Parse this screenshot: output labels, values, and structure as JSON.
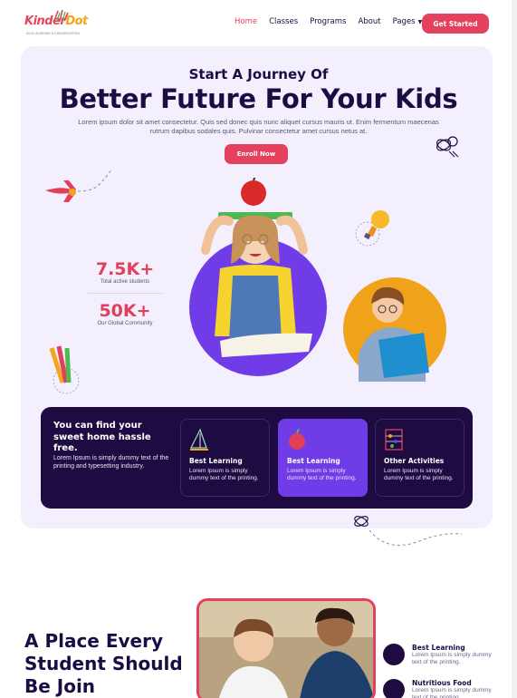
{
  "logo": {
    "kinder": "Kinder",
    "dot": "Dot",
    "tagline": "KIDS LEARNING & KINDERGARTEN"
  },
  "nav": {
    "items": [
      {
        "label": "Home",
        "active": true
      },
      {
        "label": "Classes"
      },
      {
        "label": "Programs"
      },
      {
        "label": "About"
      },
      {
        "label": "Pages"
      }
    ],
    "cta": "Get Started"
  },
  "hero": {
    "subtitle": "Start A Journey Of",
    "title": "Better Future For Your Kids",
    "description": "Lorem ipsum dolor sit amet consectetur. Quis sed donec quis nunc aliquet cursus mauris ut. Enim fermentum maecenas rutrum dapibus sodales quis. Pulvinar consectetur amet cursus netus at.",
    "button": "Enroll Now",
    "stats": [
      {
        "value": "7.5K+",
        "label": "Total active students"
      },
      {
        "value": "50K+",
        "label": "Our Global Community"
      }
    ]
  },
  "panel": {
    "title": "You can find your sweet home hassle free.",
    "description": "Lorem Ipsum is simply dummy text of the printing and typesetting industry.",
    "cards": [
      {
        "title": "Best Learning",
        "desc": "Lorem Ipsum is simply dummy text of the printing.",
        "icon": "geometry-icon"
      },
      {
        "title": "Best Learning",
        "desc": "Lorem Ipsum is simply dummy text of the printing.",
        "icon": "apple-icon",
        "active": true
      },
      {
        "title": "Other Activities",
        "desc": "Lorem Ipsum is simply dummy text of the printing.",
        "icon": "abacus-icon"
      }
    ]
  },
  "section2": {
    "title": "A Place Every Student Should Be Join",
    "features": [
      {
        "title": "Best Learning",
        "desc": "Lorem Ipsum is simply dummy text of the printing."
      },
      {
        "title": "Nutritious Food",
        "desc": "Lorem Ipsum is simply dummy text of the printing."
      }
    ]
  },
  "colors": {
    "accent": "#e5405e",
    "dark": "#1e0b42",
    "purple": "#6f3ce8",
    "hero_bg": "#f3effd"
  }
}
